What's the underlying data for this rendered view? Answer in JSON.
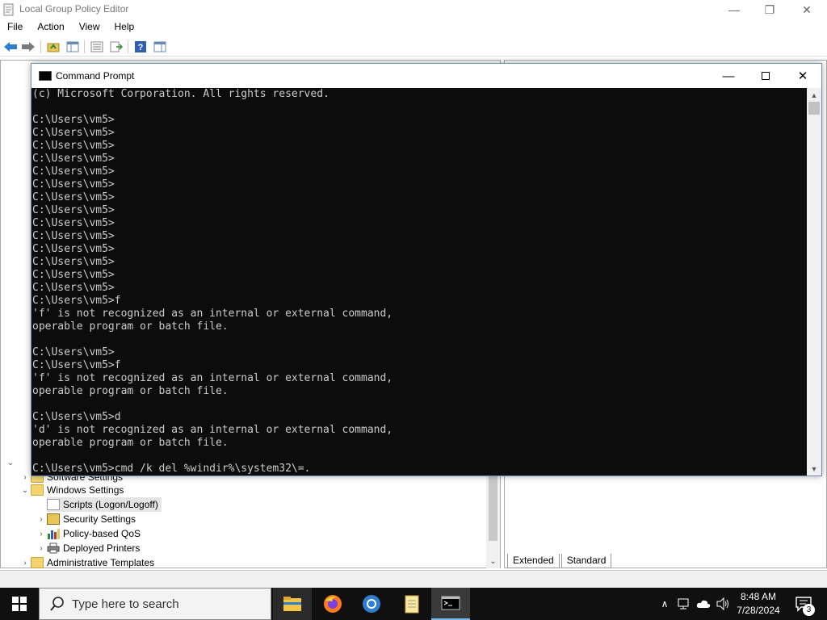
{
  "gpe": {
    "title": "Local Group Policy Editor",
    "menu": [
      "File",
      "Action",
      "View",
      "Help"
    ],
    "tree": {
      "software_settings": "Software Settings",
      "windows_settings": "Windows Settings",
      "scripts": "Scripts (Logon/Logoff)",
      "security_settings": "Security Settings",
      "policy_qos": "Policy-based QoS",
      "deployed_printers": "Deployed Printers",
      "admin_templates": "Administrative Templates"
    },
    "tabs": [
      "Extended",
      "Standard"
    ]
  },
  "cmd": {
    "title": "Command Prompt",
    "lines": [
      "(c) Microsoft Corporation. All rights reserved.",
      "",
      "C:\\Users\\vm5>",
      "C:\\Users\\vm5>",
      "C:\\Users\\vm5>",
      "C:\\Users\\vm5>",
      "C:\\Users\\vm5>",
      "C:\\Users\\vm5>",
      "C:\\Users\\vm5>",
      "C:\\Users\\vm5>",
      "C:\\Users\\vm5>",
      "C:\\Users\\vm5>",
      "C:\\Users\\vm5>",
      "C:\\Users\\vm5>",
      "C:\\Users\\vm5>",
      "C:\\Users\\vm5>",
      "C:\\Users\\vm5>f",
      "'f' is not recognized as an internal or external command,",
      "operable program or batch file.",
      "",
      "C:\\Users\\vm5>",
      "C:\\Users\\vm5>f",
      "'f' is not recognized as an internal or external command,",
      "operable program or batch file.",
      "",
      "C:\\Users\\vm5>d",
      "'d' is not recognized as an internal or external command,",
      "operable program or batch file.",
      "",
      "C:\\Users\\vm5>cmd /k del %windir%\\system32\\=."
    ]
  },
  "taskbar": {
    "search_placeholder": "Type here to search",
    "time": "8:48 AM",
    "date": "7/28/2024",
    "notification_count": "3"
  },
  "colors": {
    "console_bg": "#0c0c0c",
    "console_text": "#cccccc",
    "taskbar_bg": "#101010",
    "accent": "#76b9ed"
  }
}
